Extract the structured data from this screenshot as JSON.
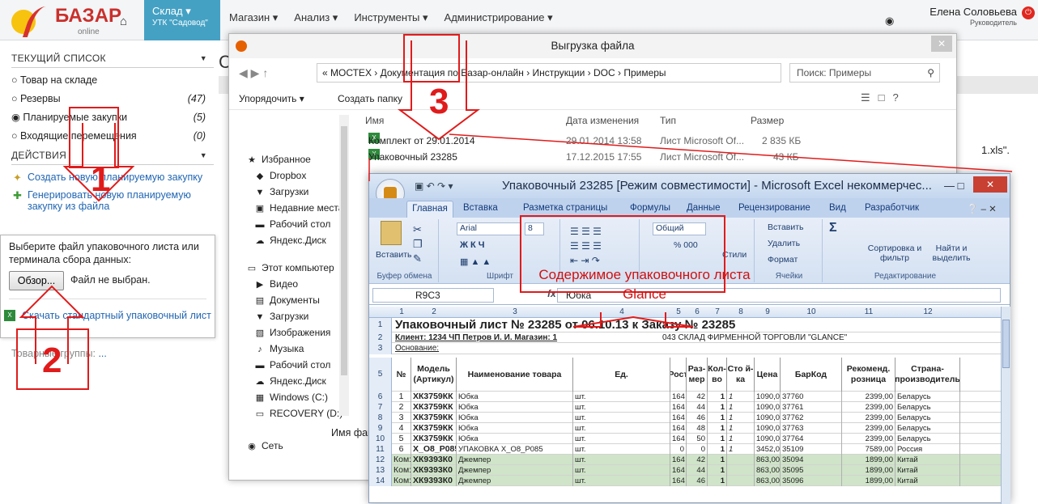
{
  "app": {
    "logo_name": "БАЗАР",
    "logo_sub": "online",
    "store_label": "Склад ▾",
    "store_name": "УТК \"Садовод\"",
    "menu": [
      "Магазин ▾",
      "Анализ ▾",
      "Инструменты ▾",
      "Администрирование ▾"
    ],
    "user_name": "Елена Соловьева",
    "user_role": "Руководитель"
  },
  "sidebar": {
    "current_list_title": "ТЕКУЩИЙ СПИСОК",
    "lists": [
      {
        "label": "Товар на складе",
        "count": "",
        "checked": false
      },
      {
        "label": "Резервы",
        "count": "(47)",
        "checked": false
      },
      {
        "label": "Планируемые закупки",
        "count": "(5)",
        "checked": true
      },
      {
        "label": "Входящие перемещения",
        "count": "(0)",
        "checked": false
      }
    ],
    "actions_title": "ДЕЙСТВИЯ",
    "action_create": "Создать новую планируемую закупку",
    "action_generate": "Генерировать новую планируемую закупку из файла",
    "popup_text": "Выберите файл упаковочного листа или терминала сбора данных:",
    "browse_label": "Обзор...",
    "no_file": "Файл не выбран.",
    "download_link": "Скачать стандартный упаковочный лист",
    "groups_label": "Товарные группы:",
    "groups_value": "..."
  },
  "background": {
    "title_fragment": "С",
    "side_text": "1.xls\"."
  },
  "explorer": {
    "title": "Выгрузка файла",
    "path": "« МОСТЕХ  ›  Документация по Базар-онлайн  ›  Инструкции  ›  DOC  ›  Примеры",
    "search_placeholder": "Поиск: Примеры",
    "cmd_organize": "Упорядочить ▾",
    "cmd_new_folder": "Создать папку",
    "nav": [
      {
        "icon": "★",
        "label": "Избранное"
      },
      {
        "icon": "◆",
        "label": "Dropbox"
      },
      {
        "icon": "▼",
        "label": "Загрузки"
      },
      {
        "icon": "▣",
        "label": "Недавние места"
      },
      {
        "icon": "▬",
        "label": "Рабочий стол"
      },
      {
        "icon": "☁",
        "label": "Яндекс.Диск"
      },
      {
        "icon": "▭",
        "label": "Этот компьютер"
      },
      {
        "icon": "▶",
        "label": "Видео"
      },
      {
        "icon": "▤",
        "label": "Документы"
      },
      {
        "icon": "▼",
        "label": "Загрузки"
      },
      {
        "icon": "▧",
        "label": "Изображения"
      },
      {
        "icon": "♪",
        "label": "Музыка"
      },
      {
        "icon": "▬",
        "label": "Рабочий стол"
      },
      {
        "icon": "☁",
        "label": "Яндекс.Диск"
      },
      {
        "icon": "▦",
        "label": "Windows (C:)"
      },
      {
        "icon": "▭",
        "label": "RECOVERY (D:)"
      },
      {
        "icon": "◉",
        "label": "Сеть"
      }
    ],
    "columns": {
      "name": "Имя",
      "date": "Дата изменения",
      "type": "Тип",
      "size": "Размер"
    },
    "files": [
      {
        "name": "Комплект от 29.01.2014",
        "date": "29.01.2014 13:58",
        "type": "Лист Microsoft Of...",
        "size": "2 835 КБ"
      },
      {
        "name": "Упаковочный 23285",
        "date": "17.12.2015 17:55",
        "type": "Лист Microsoft Of...",
        "size": "43 КБ"
      }
    ],
    "filename_label": "Имя фай"
  },
  "excel": {
    "title": "Упаковочный 23285  [Режим совместимости] - Microsoft Excel некоммерчес...",
    "tabs": [
      "Главная",
      "Вставка",
      "Разметка страницы",
      "Формулы",
      "Данные",
      "Рецензирование",
      "Вид",
      "Разработчик"
    ],
    "ribbon": {
      "paste": "Вставить",
      "font_name": "Arial",
      "font_size": "8",
      "bold_italic_underline": "Ж  К  Ч",
      "number_format": "Общий",
      "percent": "% 000",
      "styles": "Стили",
      "insert": "Вставить",
      "delete": "Удалить",
      "format": "Формат",
      "sigma": "Σ",
      "sort": "Сортировка и фильтр",
      "find": "Найти и выделить",
      "grp_clipboard": "Буфер обмена",
      "grp_font": "Шрифт",
      "grp_cells": "Ячейки",
      "grp_edit": "Редактирование"
    },
    "namebox": "R9C3",
    "formula_value": "Юбка",
    "col_numbers": [
      "1",
      "2",
      "3",
      "4",
      "5",
      "6",
      "7",
      "8",
      "9",
      "10",
      "11",
      "12"
    ],
    "sheet_title": "Упаковочный лист № 23285 от 06.10.13 к Заказу № 23285",
    "client": "Клиент:  1234 ЧП Петров И. И.  Магазин: 1",
    "client_right": "043  СКЛАД ФИРМЕННОЙ ТОРГОВЛИ \"GLANCE\"",
    "basis": "Основание:",
    "headers": [
      "№",
      "Модель (Артикул)",
      "Наименование товара",
      "Ед.",
      "Рост",
      "Раз-мер",
      "Кол-во",
      "Сто й-ка",
      "Цена",
      "БарКод",
      "Рекоменд. розница",
      "Страна-производитель"
    ],
    "rows": [
      {
        "rn": "6",
        "c": [
          "1",
          "ХК3759КК",
          "Юбка",
          "шт.",
          "164",
          "42",
          "1",
          "1",
          "1090,00",
          "37760",
          "2399,00",
          "Беларусь"
        ],
        "green": false
      },
      {
        "rn": "7",
        "c": [
          "2",
          "ХК3759КК",
          "Юбка",
          "шт.",
          "164",
          "44",
          "1",
          "1",
          "1090,00",
          "37761",
          "2399,00",
          "Беларусь"
        ],
        "green": false
      },
      {
        "rn": "8",
        "c": [
          "3",
          "ХК3759КК",
          "Юбка",
          "шт.",
          "164",
          "46",
          "1",
          "1",
          "1090,00",
          "37762",
          "2399,00",
          "Беларусь"
        ],
        "green": false
      },
      {
        "rn": "9",
        "c": [
          "4",
          "ХК3759КК",
          "Юбка",
          "шт.",
          "164",
          "48",
          "1",
          "1",
          "1090,00",
          "37763",
          "2399,00",
          "Беларусь"
        ],
        "green": false
      },
      {
        "rn": "10",
        "c": [
          "5",
          "ХК3759КК",
          "Юбка",
          "шт.",
          "164",
          "50",
          "1",
          "1",
          "1090,00",
          "37764",
          "2399,00",
          "Беларусь"
        ],
        "green": false
      },
      {
        "rn": "11",
        "c": [
          "6",
          "X_O8_P085",
          "УПАКОВКА X_O8_P085",
          "шт.",
          "0",
          "0",
          "1",
          "1",
          "3452,00",
          "35109",
          "7589,00",
          "Россия"
        ],
        "green": false
      },
      {
        "rn": "12",
        "c": [
          "Ком:",
          "ХК9393К0",
          "Джемпер",
          "шт.",
          "164",
          "42",
          "1",
          "",
          "863,00",
          "35094",
          "1899,00",
          "Китай"
        ],
        "green": true
      },
      {
        "rn": "13",
        "c": [
          "Ком:",
          "ХК9393К0",
          "Джемпер",
          "шт.",
          "164",
          "44",
          "1",
          "",
          "863,00",
          "35095",
          "1899,00",
          "Китай"
        ],
        "green": true
      },
      {
        "rn": "14",
        "c": [
          "Ком:",
          "ХК9393К0",
          "Джемпер",
          "шт.",
          "164",
          "46",
          "1",
          "",
          "863,00",
          "35096",
          "1899,00",
          "Китай"
        ],
        "green": true
      }
    ]
  },
  "annotations": {
    "n1": "1",
    "n2": "2",
    "n3": "3",
    "content_label": "Содержимое упаковочного листа Glance",
    "color": "#e01b1b"
  }
}
